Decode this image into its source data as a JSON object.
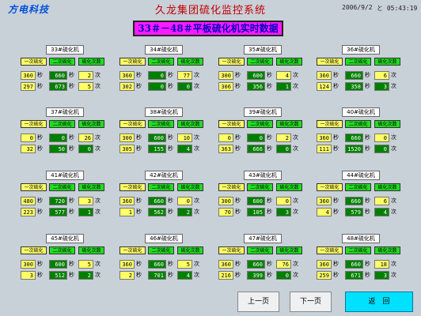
{
  "header": {
    "logo": "方电科技",
    "title": "久龙集团硫化监控系统",
    "date": "2006/9/2",
    "time": "と 05:43:19"
  },
  "banner": "33＃－48＃平板硫化机实时数据",
  "units": {
    "sec": "秒",
    "times": "次"
  },
  "panel_headers": {
    "h1": "一次硫化",
    "h2": "二次硫化",
    "h3": "硫化次数"
  },
  "panels": [
    {
      "title": "33#硫化机",
      "r1": [
        "360",
        "660",
        "2"
      ],
      "r2": [
        "297",
        "673",
        "5"
      ],
      "r2_dark": false
    },
    {
      "title": "34#硫化机",
      "r1": [
        "360",
        "0",
        "77"
      ],
      "r2": [
        "302",
        "0",
        "0"
      ],
      "r2_dark": true
    },
    {
      "title": "35#硫化机",
      "r1": [
        "300",
        "600",
        "4"
      ],
      "r2": [
        "306",
        "356",
        "1"
      ],
      "r2_dark": true
    },
    {
      "title": "36#硫化机",
      "r1": [
        "360",
        "660",
        "6"
      ],
      "r2": [
        "124",
        "358",
        "3"
      ],
      "r2_dark": true
    },
    {
      "title": "37#硫化机",
      "r1": [
        "0",
        "0",
        "26"
      ],
      "r2": [
        "32",
        "50",
        "0"
      ],
      "r2_dark": true
    },
    {
      "title": "38#硫化机",
      "r1": [
        "300",
        "600",
        "10"
      ],
      "r2": [
        "305",
        "155",
        "4"
      ],
      "r2_dark": true
    },
    {
      "title": "39#硫化机",
      "r1": [
        "0",
        "0",
        "2"
      ],
      "r2": [
        "363",
        "666",
        "0"
      ],
      "r2_dark": true
    },
    {
      "title": "40#硫化机",
      "r1": [
        "360",
        "660",
        "0"
      ],
      "r2": [
        "111",
        "1520",
        "0"
      ],
      "r2_dark": true
    },
    {
      "title": "41#硫化机",
      "r1": [
        "480",
        "720",
        "3"
      ],
      "r2": [
        "223",
        "577",
        "1"
      ],
      "r2_dark": true
    },
    {
      "title": "42#硫化机",
      "r1": [
        "360",
        "660",
        "0"
      ],
      "r2": [
        "1",
        "562",
        "2"
      ],
      "r2_dark": true
    },
    {
      "title": "43#硫化机",
      "r1": [
        "300",
        "600",
        "0"
      ],
      "r2": [
        "70",
        "105",
        "3"
      ],
      "r2_dark": true
    },
    {
      "title": "44#硫化机",
      "r1": [
        "360",
        "660",
        "6"
      ],
      "r2": [
        "4",
        "579",
        "4"
      ],
      "r2_dark": true
    },
    {
      "title": "45#硫化机",
      "r1": [
        "300",
        "600",
        "5"
      ],
      "r2": [
        "3",
        "512",
        "2"
      ],
      "r2_dark": true
    },
    {
      "title": "46#硫化机",
      "r1": [
        "360",
        "660",
        "5"
      ],
      "r2": [
        "2",
        "701",
        "4"
      ],
      "r2_dark": true
    },
    {
      "title": "47#硫化机",
      "r1": [
        "360",
        "660",
        "76"
      ],
      "r2": [
        "216",
        "399",
        "0"
      ],
      "r2_dark": true
    },
    {
      "title": "48#硫化机",
      "r1": [
        "360",
        "660",
        "18"
      ],
      "r2": [
        "259",
        "671",
        "3"
      ],
      "r2_dark": true
    }
  ],
  "buttons": {
    "prev": "上一页",
    "next": "下一页",
    "back": "返　回"
  }
}
